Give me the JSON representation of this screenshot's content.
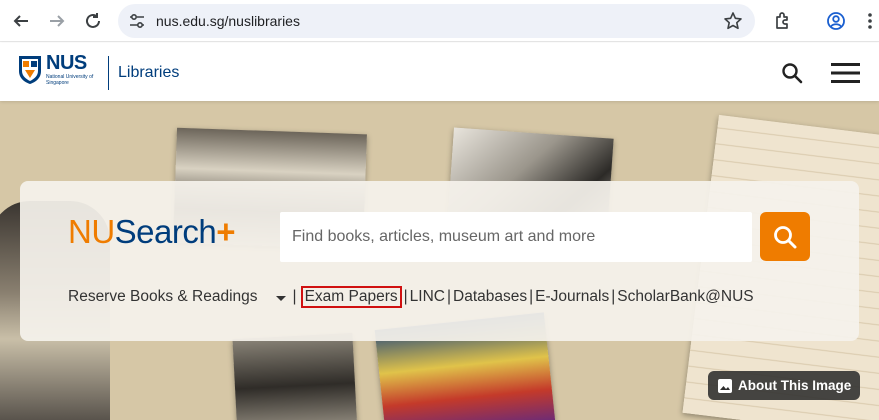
{
  "browser": {
    "url": "nus.edu.sg/nuslibraries",
    "icons": [
      "back-arrow-icon",
      "forward-arrow-icon",
      "reload-icon",
      "site-settings-icon",
      "star-icon",
      "extensions-icon",
      "profile-icon",
      "more-icon"
    ]
  },
  "header": {
    "logo_text": "NUS",
    "logo_subtext": "National University of Singapore",
    "section_title": "Libraries",
    "icons": [
      "search-icon",
      "hamburger-menu-icon"
    ]
  },
  "search": {
    "brand_nu": "NU",
    "brand_search": "Search",
    "brand_plus": "+",
    "placeholder": "Find books, articles, museum art and more",
    "links": {
      "reserve": "Reserve Books & Readings",
      "exam": "Exam Papers",
      "linc": "LINC",
      "databases": "Databases",
      "ejournals": "E-Journals",
      "scholarbank": "ScholarBank@NUS"
    },
    "separator": "|"
  },
  "about_button": "About This Image",
  "colors": {
    "accent": "#ef7c00",
    "brand_blue": "#003d7c",
    "highlight": "#d01010"
  }
}
